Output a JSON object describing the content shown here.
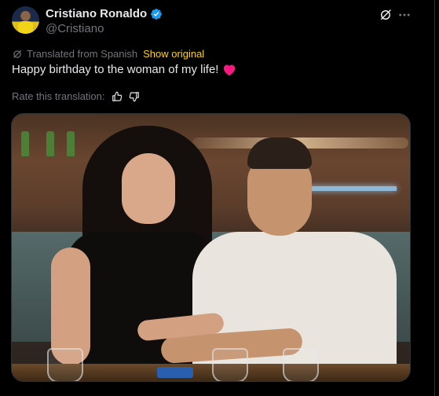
{
  "author": {
    "display_name": "Cristiano Ronaldo",
    "handle": "@Cristiano",
    "verified": true,
    "avatar_icon": "avatar-image"
  },
  "actions": {
    "grok_icon": "grok-icon",
    "more_icon": "more-icon"
  },
  "translation": {
    "label": "Translated from Spanish",
    "show_original": "Show original",
    "rate_label": "Rate this translation:"
  },
  "tweet": {
    "text": "Happy birthday to the woman of my life!",
    "emoji_icon": "red-heart-icon"
  },
  "media": {
    "type": "photo"
  },
  "colors": {
    "background": "#000000",
    "text_primary": "#e7e9ea",
    "text_secondary": "#71767b",
    "verified_blue": "#1d9bf0",
    "show_original_yellow": "#ffd400",
    "heart_red": "#f91880"
  }
}
